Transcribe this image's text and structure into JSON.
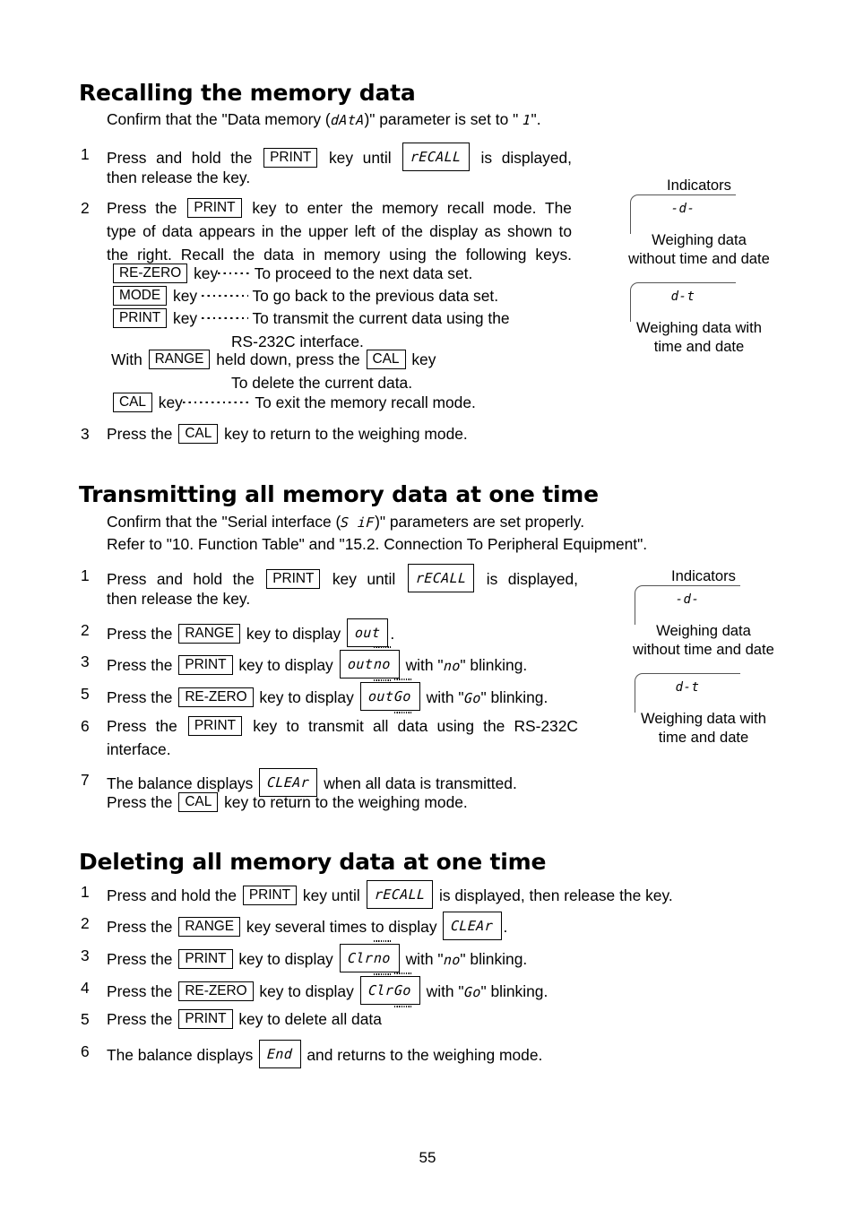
{
  "page": {
    "number": "55"
  },
  "sections": [
    {
      "id": "recalling",
      "heading": "Recalling the memory data",
      "intro": {
        "pre": "Confirm that the \"Data memory (",
        "seg": "dAtA",
        "mid": ")\" parameter is set to \" ",
        "seg2": "1",
        "post": "\"."
      },
      "steps": [
        {
          "num": "1",
          "line1_a": "Press and hold the",
          "key1": "PRINT",
          "line1_b": "key until",
          "lcd1": "rECALL",
          "line1_c": "is displayed,",
          "line2": "then release the key."
        },
        {
          "num": "2",
          "line1_a": "Press the",
          "key1": "PRINT",
          "line1_b": "key to enter the memory recall mode. The",
          "line2": "type of data appears in the upper left of the display as shown to",
          "line3": "the right. Recall the data in memory using the following keys.",
          "keyrows": [
            {
              "key": "RE-ZERO",
              "word": "key",
              "desc": "To proceed to the next data set."
            },
            {
              "key": "MODE",
              "word": "key",
              "desc": "To go back to the previous data set."
            },
            {
              "key": "PRINT",
              "word": "key",
              "desc_a": "To  transmit  the  current  data  using  the",
              "desc_b": "RS-232C interface."
            }
          ],
          "with_row": {
            "pre": "With",
            "key1": "RANGE",
            "mid": "held down, press the",
            "key2": "CAL",
            "post": "key",
            "desc": "To delete the current data."
          },
          "cal_row": {
            "key": "CAL",
            "word": "key",
            "desc": "To exit the memory recall mode."
          }
        },
        {
          "num": "3",
          "line1_a": "Press the",
          "key1": "CAL",
          "line1_b": "key to return to the weighing mode."
        }
      ]
    },
    {
      "id": "transmitting",
      "heading": "Transmitting all memory data at one time",
      "intro_line1": {
        "pre": "Confirm that the \"Serial interface (",
        "seg": "S iF",
        "post": ")\" parameters are set properly."
      },
      "intro_line2": "Refer to \"10. Function Table\" and \"15.2. Connection To Peripheral Equipment\".",
      "steps": [
        {
          "num": "1",
          "a": "Press and hold the",
          "key": "PRINT",
          "b": "key until",
          "lcd": "rECALL",
          "c": "is displayed,",
          "line2": "then release the key."
        },
        {
          "num": "2",
          "a": "Press the",
          "key": "RANGE",
          "b": "key to display",
          "lcd": "out",
          "c": "."
        },
        {
          "num": "3",
          "a": "Press the",
          "key": "PRINT",
          "b": "key to display",
          "lcd_static": "out ",
          "lcd_blink": "no",
          "c": "with \"",
          "c_seg": "no",
          "c2": "\" blinking."
        },
        {
          "num": "5",
          "a": "Press the",
          "key": "RE-ZERO",
          "b": "key to display",
          "lcd_static": "out ",
          "lcd_blink": "Go",
          "c": "with \"",
          "c_seg": "Go",
          "c2": "\" blinking."
        },
        {
          "num": "6",
          "a": "Press  the",
          "key": "PRINT",
          "b": "key  to  transmit  all  data  using  the  RS-232C",
          "line2": "interface."
        },
        {
          "num": "7",
          "a": "The balance displays",
          "lcd": "CLEAr",
          "b": "when all data is transmitted.",
          "line2_a": "Press the",
          "key2": "CAL",
          "line2_b": "key to return to the weighing mode."
        }
      ]
    },
    {
      "id": "deleting",
      "heading": "Deleting all memory data at one time",
      "steps": [
        {
          "num": "1",
          "a": "Press and hold the",
          "key": "PRINT",
          "b": "key until",
          "lcd": "rECALL",
          "c": "is displayed, then release the key."
        },
        {
          "num": "2",
          "a": "Press the",
          "key": "RANGE",
          "b": "key several times to display",
          "lcd": "CLEAr",
          "c": "."
        },
        {
          "num": "3",
          "a": "Press the",
          "key": "PRINT",
          "b": "key to display",
          "lcd_static": "Clr ",
          "lcd_blink": "no",
          "c": "with \"",
          "c_seg": "no",
          "c2": "\" blinking."
        },
        {
          "num": "4",
          "a": "Press the",
          "key": "RE-ZERO",
          "b": "key to display",
          "lcd_static": "Clr ",
          "lcd_blink": "Go",
          "c": "with \"",
          "c_seg": "Go",
          "c2": "\" blinking."
        },
        {
          "num": "5",
          "a": "Press the",
          "key": "PRINT",
          "b": "key to delete all data"
        },
        {
          "num": "6",
          "a": "The balance displays",
          "lcd": "End",
          "b": "and returns to the weighing mode."
        }
      ]
    }
  ],
  "indicators": [
    {
      "title": "Indicators",
      "items": [
        {
          "seg": "-d-",
          "cap_line1": "Weighing data",
          "cap_line2": "without time and date"
        },
        {
          "seg": "d-t",
          "cap_line1": "Weighing data with",
          "cap_line2": "time and date"
        }
      ]
    },
    {
      "title": "Indicators",
      "items": [
        {
          "seg": "-d-",
          "cap_line1": "Weighing data",
          "cap_line2": "without time and date"
        },
        {
          "seg": "d-t",
          "cap_line1": "Weighing data with",
          "cap_line2": "time and date"
        }
      ]
    }
  ]
}
